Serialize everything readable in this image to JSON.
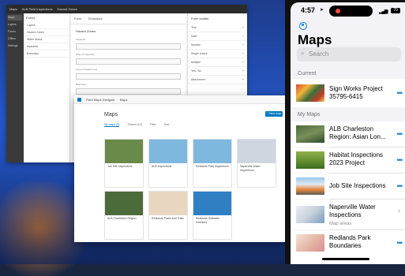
{
  "back_window": {
    "top_items": [
      "Maps",
      "ALB Field Inspections",
      "Hazard Zones"
    ],
    "sidebar": [
      "Maps",
      "Layers",
      "Forms",
      "Offline",
      "Settings"
    ],
    "panel_title": "Forms",
    "panel_items": [
      "Layers",
      "Hazard Zones",
      "Water Mains",
      "Hydrants",
      "Boundary"
    ],
    "tabs": [
      "Form",
      "Templates"
    ],
    "section": "Hazard Zones",
    "fields": [
      "Inspector",
      "Date of inspection",
      "Type of hazard zone",
      "Risk level"
    ],
    "right_title": "Form builder",
    "right_rows": [
      "Text",
      "Date",
      "Number",
      "Single choice",
      "Multiple",
      "Yes / No",
      "Attachment"
    ]
  },
  "front_window": {
    "top_app": "Field Maps Designer",
    "top_crumb": "Maps",
    "page_title": "Maps",
    "new_button": "+ New map",
    "tabs": [
      "My maps (8)",
      "Shared (12)",
      "Filter",
      "Sort"
    ],
    "cards": [
      {
        "title": "Job Site Inspections",
        "color": "#6a8a4a"
      },
      {
        "title": "ALB Inspections",
        "color": "#7fb8de"
      },
      {
        "title": "Redlands Park Inspections",
        "color": "#7fb8de"
      },
      {
        "title": "Naperville Water Inspections",
        "color": "#cfd6de"
      },
      {
        "title": "ALB Charleston Region",
        "color": "#4c6b3a"
      },
      {
        "title": "Redlands Parks and Trails",
        "color": "#e8d6c0"
      },
      {
        "title": "Redlands Sidewalk Inventory",
        "color": "#2f7fc2"
      }
    ]
  },
  "phone": {
    "time": "4:57",
    "battery": "70",
    "title": "Maps",
    "search_placeholder": "Search",
    "current_label": "Current",
    "current": {
      "title": "Sign Works Project 35795-6415"
    },
    "my_maps_label": "My Maps",
    "my_maps": [
      {
        "title": "ALB Charleston Region: Asian Lon...",
        "sub": ""
      },
      {
        "title": "Habitat Inspections 2023 Project",
        "sub": ""
      },
      {
        "title": "Job Site Inspections",
        "sub": ""
      },
      {
        "title": "Naperville Water Inspections",
        "sub": "Map areas"
      },
      {
        "title": "Redlands Park Boundaries",
        "sub": ""
      }
    ]
  },
  "colors": {
    "accent": "#0a7bd6",
    "esri_blue": "#0079c1"
  }
}
